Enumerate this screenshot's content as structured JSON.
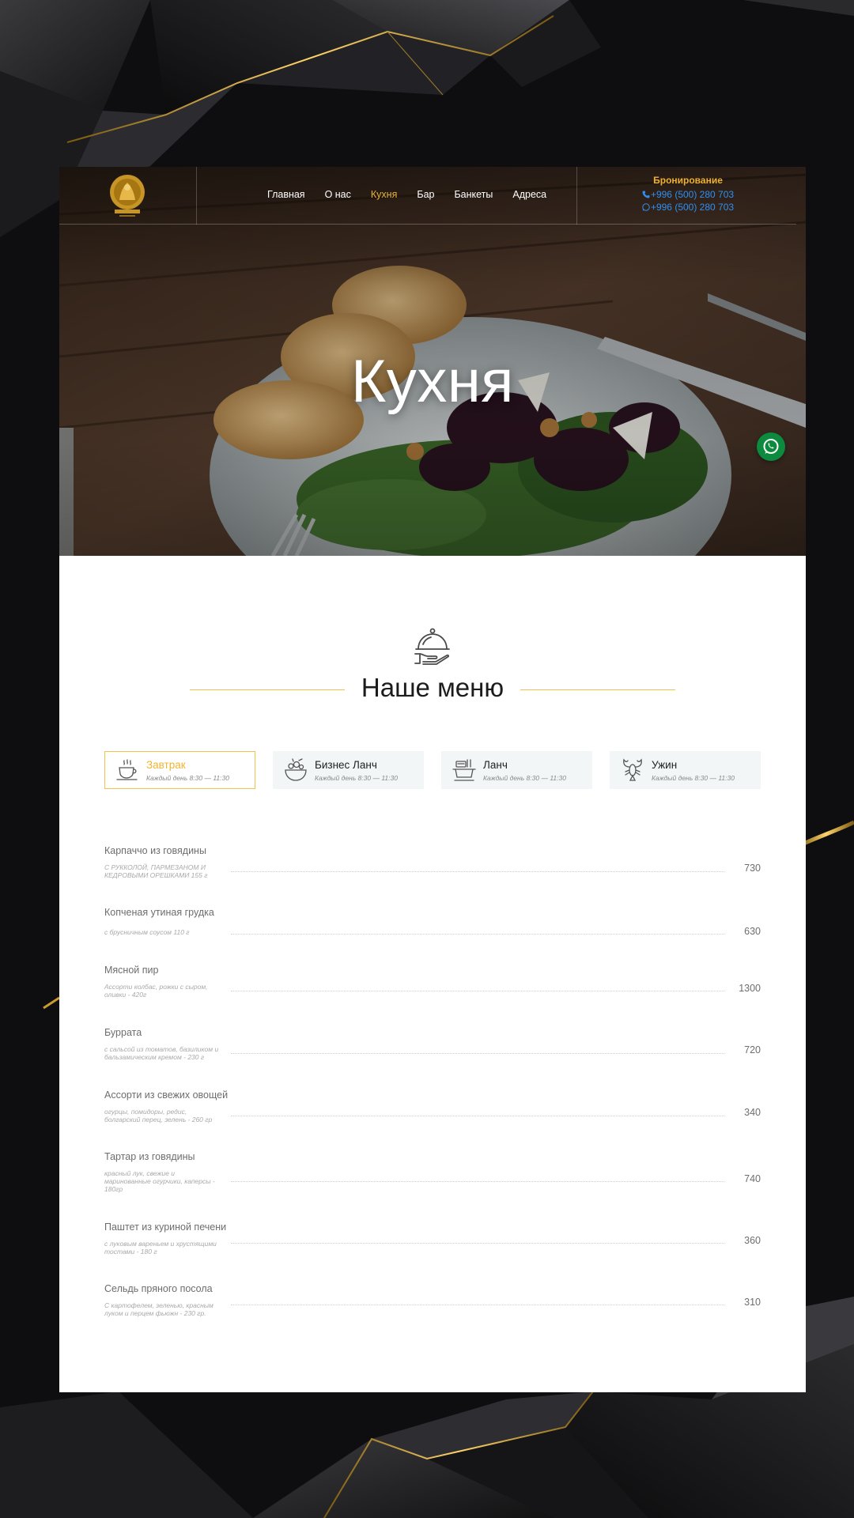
{
  "header": {
    "logo_alt": "Дамбинус",
    "nav": [
      "Главная",
      "О нас",
      "Кухня",
      "Бар",
      "Банкеты",
      "Адреса"
    ],
    "active_nav": "Кухня",
    "booking_title": "Бронирование",
    "phone": "+996 (500) 280 703",
    "whatsapp": "+996 (500) 280 703"
  },
  "hero": {
    "title": "Кухня"
  },
  "menu": {
    "title": "Наше меню",
    "tabs": [
      {
        "name": "Завтрак",
        "time": "Каждый день  8:30 — 11:30",
        "icon": "coffee-cup-icon",
        "active": true
      },
      {
        "name": "Бизнес Ланч",
        "time": "Каждый день  8:30 — 11:30",
        "icon": "salad-bowl-icon",
        "active": false
      },
      {
        "name": "Ланч",
        "time": "Каждый день  8:30 — 11:30",
        "icon": "soup-pot-icon",
        "active": false
      },
      {
        "name": "Ужин",
        "time": "Каждый день  8:30 — 11:30",
        "icon": "lobster-icon",
        "active": false
      }
    ],
    "items": [
      {
        "name": "Карпаччо из говядины",
        "desc": "С РУККОЛОЙ, ПАРМЕЗАНОМ И КЕДРОВЫМИ ОРЕШКАМИ 155 г",
        "price": "730"
      },
      {
        "name": "Копченая утиная грудка",
        "desc": "с брусничным соусом 110 г",
        "price": "630"
      },
      {
        "name": "Мясной пир",
        "desc": "Ассорти колбас, рожки с сыром, оливки - 420г",
        "price": "1300"
      },
      {
        "name": "Буррата",
        "desc": "с сальсой из томатов, базиликом и бальзамическим кремом - 230 г",
        "price": "720"
      },
      {
        "name": "Ассорти из свежих овощей",
        "desc": "огурцы, помидоры, редис, болгарский перец, зелень - 260 гр",
        "price": "340"
      },
      {
        "name": "Тартар из говядины",
        "desc": "красный лук, свежие и маринованные огурчики, каперсы - 180гр",
        "price": "740"
      },
      {
        "name": "Паштет из куриной печени",
        "desc": "с луковым вареньем и хрустящими тостами - 180 г",
        "price": "360"
      },
      {
        "name": "Сельдь пряного посола",
        "desc": "С картофелем, зеленью, красным луком и перцем фьюжн - 230 гр.",
        "price": "310"
      }
    ]
  },
  "colors": {
    "accent": "#efb531",
    "link": "#2f8ff0",
    "whatsapp": "#0c8a3d"
  }
}
